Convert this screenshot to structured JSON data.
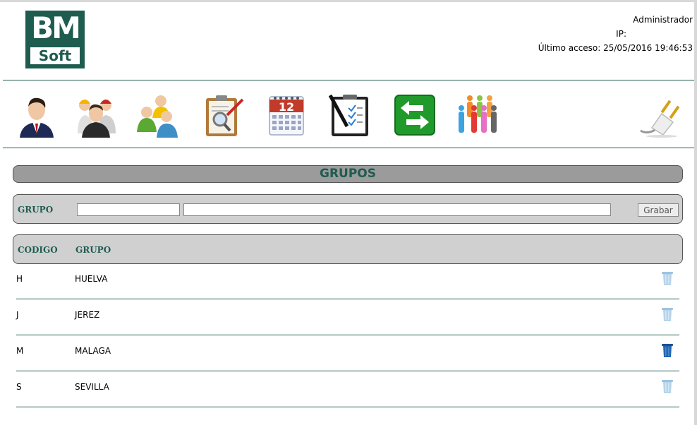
{
  "header": {
    "logo_top": "BM",
    "logo_bottom": "Soft",
    "user": "Administrador",
    "ip_label": "IP:",
    "last_access": "Último acceso: 25/05/2016 19:46:53"
  },
  "toolbar": {
    "items": [
      {
        "icon": "user-icon"
      },
      {
        "icon": "workers-icon"
      },
      {
        "icon": "users-group-icon"
      },
      {
        "icon": "clipboard-search-icon"
      },
      {
        "icon": "calendar-icon",
        "calendar_day": "12"
      },
      {
        "icon": "checklist-icon"
      },
      {
        "icon": "transfer-arrows-icon"
      },
      {
        "icon": "people-crowd-icon"
      },
      {
        "icon": "plug-icon"
      }
    ]
  },
  "page": {
    "title": "GRUPOS"
  },
  "form": {
    "label": "GRUPO",
    "code_value": "",
    "name_value": "",
    "save_label": "Grabar"
  },
  "table": {
    "columns": [
      "CODIGO",
      "GRUPO"
    ],
    "rows": [
      {
        "code": "H",
        "name": "HUELVA",
        "delete_active": false
      },
      {
        "code": "J",
        "name": "JEREZ",
        "delete_active": false
      },
      {
        "code": "M",
        "name": "MALAGA",
        "delete_active": true
      },
      {
        "code": "S",
        "name": "SEVILLA",
        "delete_active": false
      }
    ]
  },
  "colors": {
    "brand": "#1f5c50",
    "title_bar": "#9b9b9b",
    "panel": "#d0d0d0"
  }
}
